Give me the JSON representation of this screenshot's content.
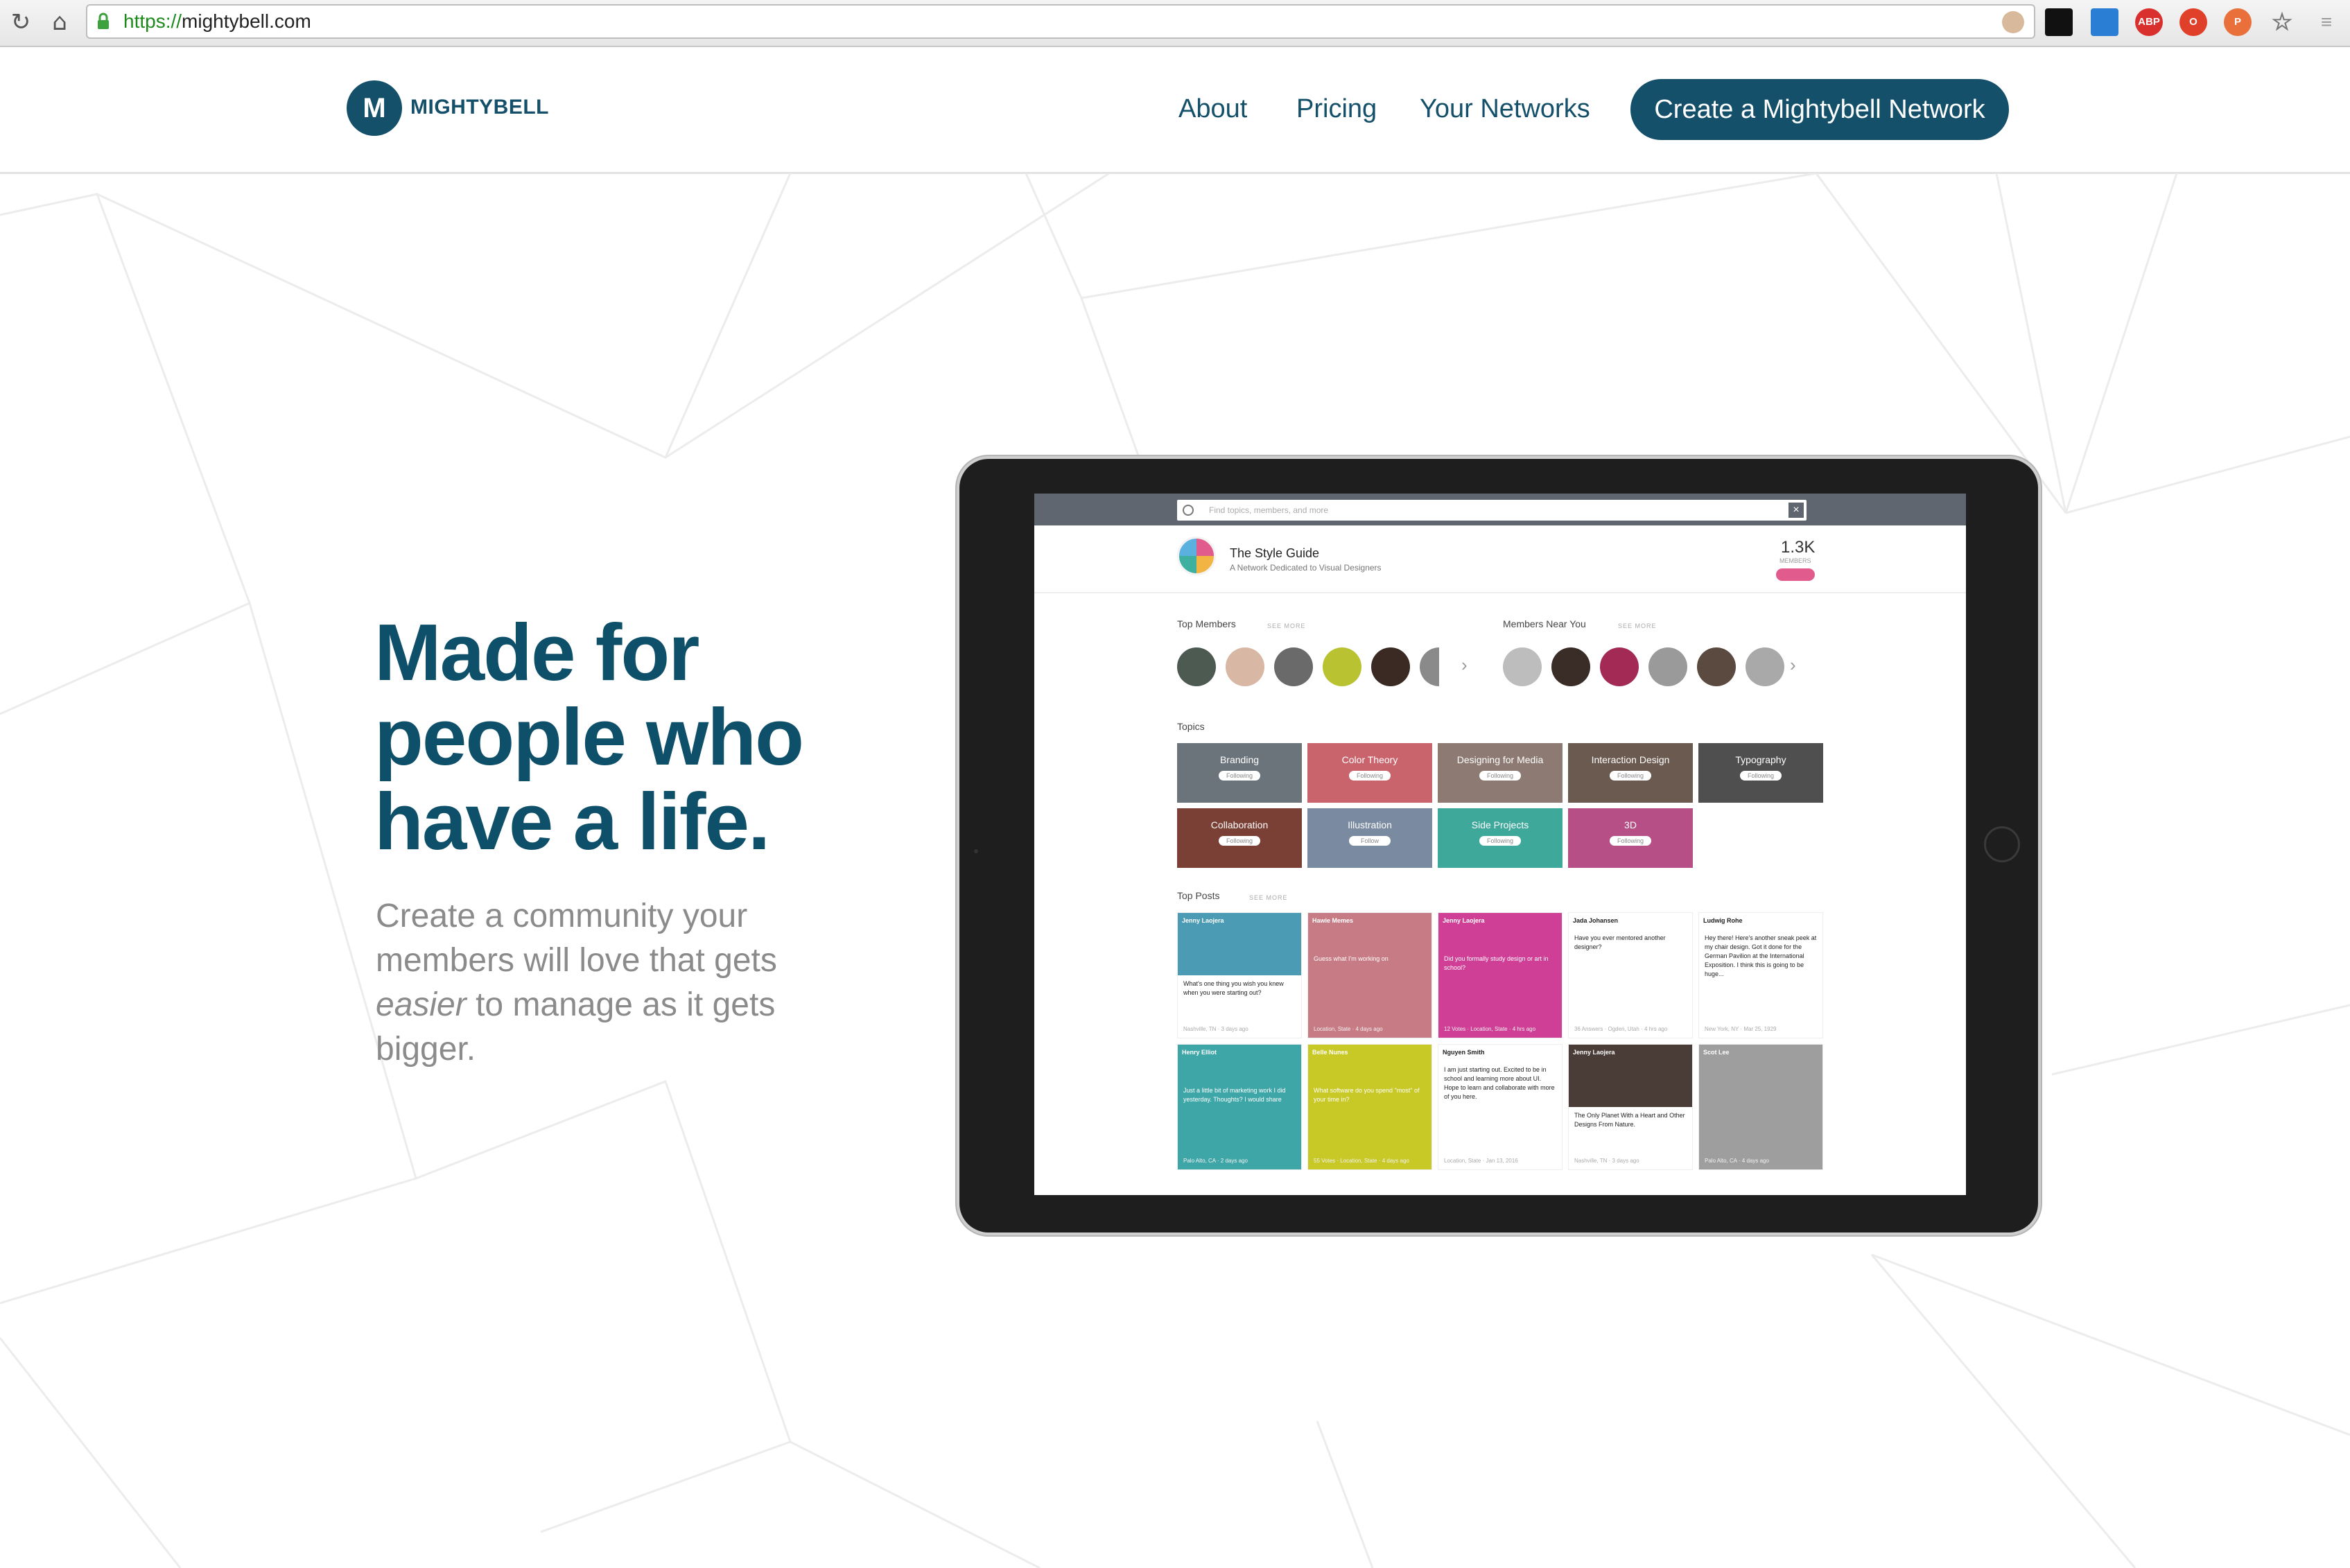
{
  "browser": {
    "url_scheme": "https://",
    "url_host": "mightybell.com"
  },
  "header": {
    "logo_letter": "M",
    "logo_text": "MIGHTYBELL",
    "nav": [
      "About",
      "Pricing",
      "Your Networks"
    ],
    "cta": "Create a Mightybell Network"
  },
  "hero": {
    "headline": "Made for people who have a life.",
    "subtext_before": "Create a community your members will love that gets ",
    "subtext_em": "easier",
    "subtext_after": " to manage as it gets bigger."
  },
  "app": {
    "search_placeholder": "Find topics, members, and more",
    "network_name": "The Style Guide",
    "network_tagline": "A Network Dedicated to Visual Designers",
    "members_count": "1.3K",
    "members_label": "MEMBERS",
    "top_members_label": "Top Members",
    "members_near_label": "Members Near You",
    "see_more": "SEE MORE",
    "topics_label": "Topics",
    "topics": [
      {
        "name": "Branding",
        "status": "Following",
        "color": "#6b737b"
      },
      {
        "name": "Color Theory",
        "status": "Following",
        "color": "#c9646d"
      },
      {
        "name": "Designing for Media",
        "status": "Following",
        "color": "#8c7a73"
      },
      {
        "name": "Interaction Design",
        "status": "Following",
        "color": "#6b5a4f"
      },
      {
        "name": "Typography",
        "status": "Following",
        "color": "#4f4f4f"
      },
      {
        "name": "Collaboration",
        "status": "Following",
        "color": "#7a3f35"
      },
      {
        "name": "Illustration",
        "status": "Follow",
        "color": "#7a8aa0"
      },
      {
        "name": "Side Projects",
        "status": "Following",
        "color": "#3ea89b"
      },
      {
        "name": "3D",
        "status": "Following",
        "color": "#b74f87"
      }
    ],
    "top_posts_label": "Top Posts",
    "posts": [
      {
        "author": "Jenny Laojera",
        "text": "What's one thing you wish you knew when you were starting out?",
        "meta": "Nashville, TN · 3 days ago",
        "color": "#4b9bb4",
        "style": "photo"
      },
      {
        "author": "Hawie Memes",
        "text": "Guess what I'm working on",
        "meta": "Location, State · 4 days ago",
        "color": "#c77c85",
        "style": "full"
      },
      {
        "author": "Jenny Laojera",
        "text": "Did you formally study design or art in school?",
        "meta": "12 Votes · Location, State · 4 hrs ago",
        "color": "#cf3f96",
        "style": "full"
      },
      {
        "author": "Jada Johansen",
        "text": "Have you ever mentored another designer?",
        "meta": "36 Answers · Ogden, Utah · 4 hrs ago",
        "color": "#ffffff",
        "style": "light"
      },
      {
        "author": "Ludwig Rohe",
        "text": "Hey there! Here's another sneak peek at my chair design. Got it done for the German Pavilion at the International Exposition. I think this is going to be huge...",
        "meta": "New York, NY · Mar 25, 1929",
        "color": "#ffffff",
        "style": "light"
      },
      {
        "author": "Henry Elliot",
        "text": "Just a little bit of marketing work I did yesterday. Thoughts? I would share",
        "meta": "Palo Alto, CA · 2 days ago",
        "color": "#3fa6a8",
        "style": "full"
      },
      {
        "author": "Belle Nunes",
        "text": "What software do you spend \"most\" of your time in?",
        "meta": "55 Votes · Location, State · 4 days ago",
        "color": "#c8c827",
        "style": "full"
      },
      {
        "author": "Nguyen Smith",
        "text": "I am just starting out. Excited to be in school and learning more about UI. Hope to learn and collaborate with more of you here.",
        "meta": "Location, State · Jan 13, 2016",
        "color": "#ffffff",
        "style": "light"
      },
      {
        "author": "Jenny Laojera",
        "text": "The Only Planet With a Heart and Other Designs From Nature.",
        "meta": "Nashville, TN · 3 days ago",
        "color": "#4a3c36",
        "style": "photo"
      },
      {
        "author": "Scot Lee",
        "text": "",
        "meta": "Palo Alto, CA · 4 days ago",
        "color": "#9e9e9e",
        "style": "full"
      }
    ]
  }
}
